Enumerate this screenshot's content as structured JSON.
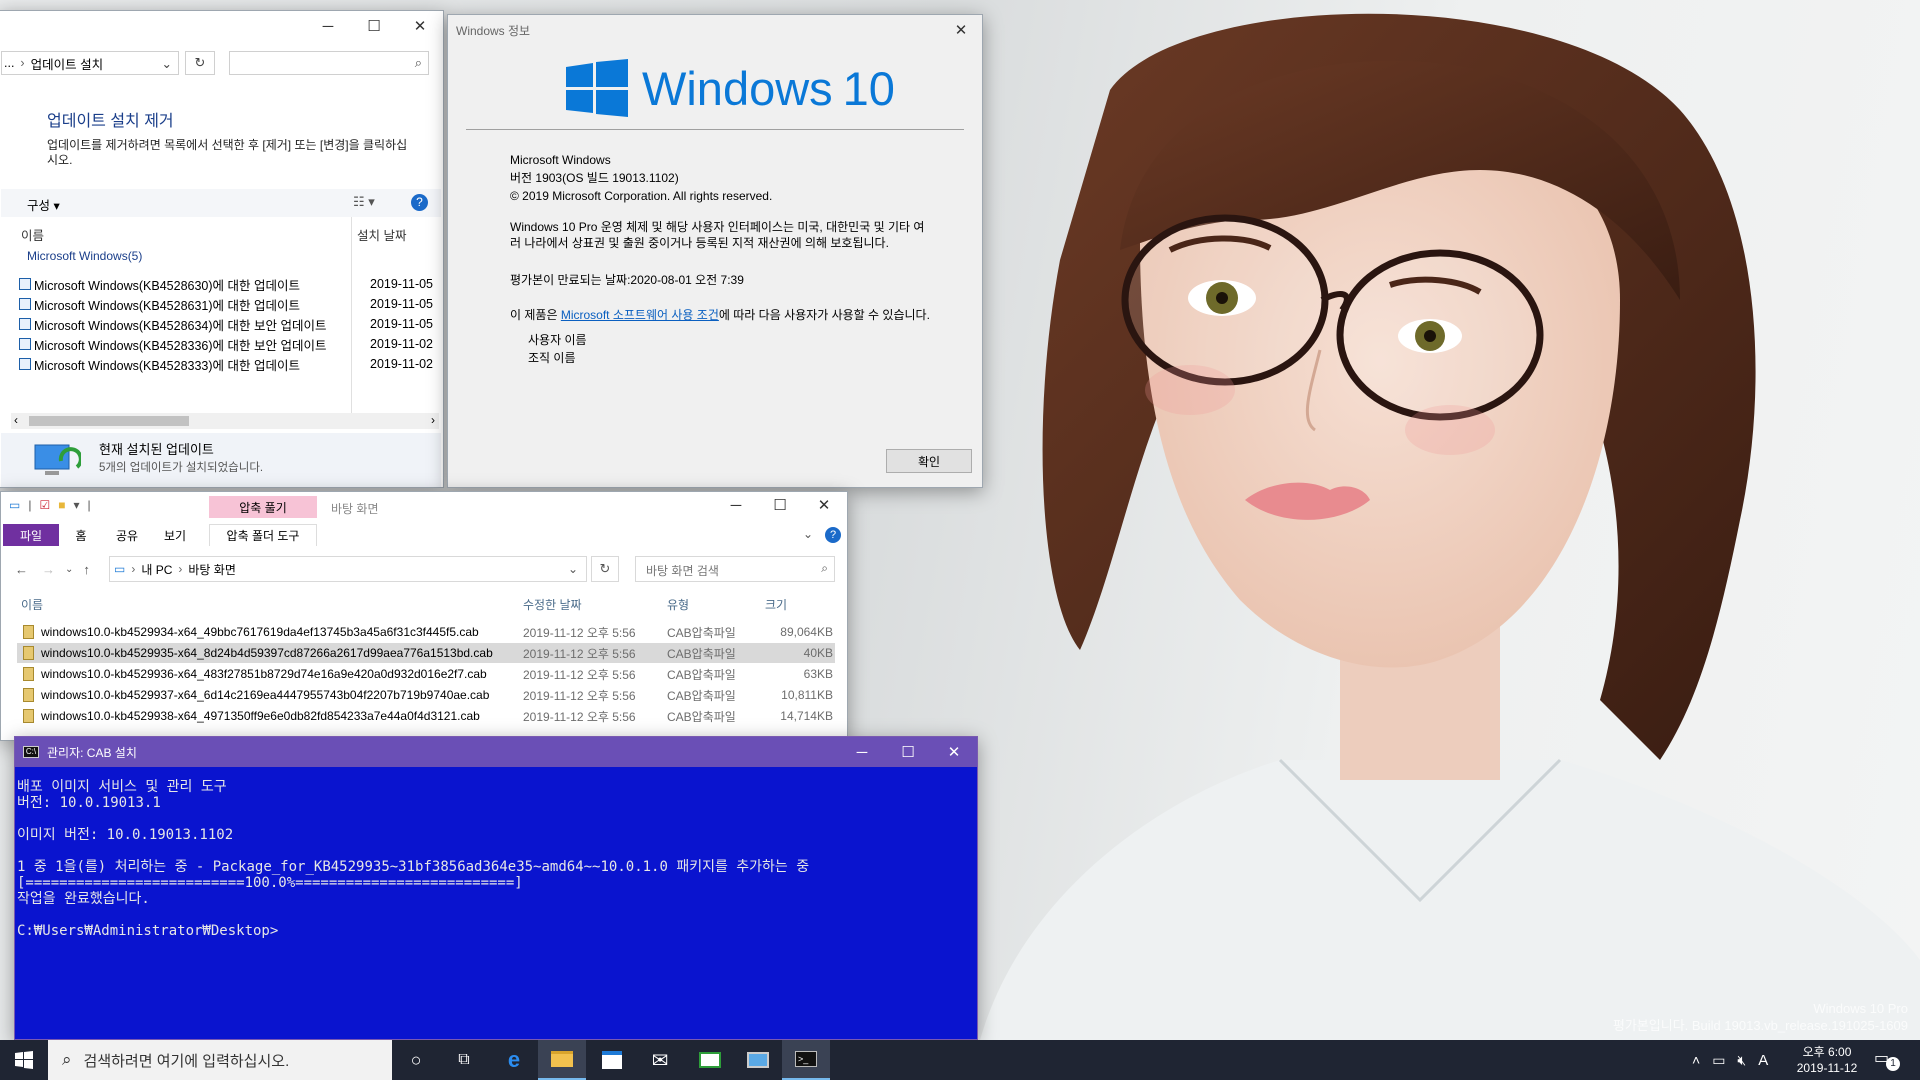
{
  "update_window": {
    "breadcrumb_prefix": "...",
    "breadcrumb": "업데이트 설치",
    "heading": "업데이트 설치 제거",
    "description": "업데이트를 제거하려면 목록에서 선택한 후 [제거] 또는 [변경]을 클릭하십시오.",
    "organize": "구성",
    "col_name": "이름",
    "col_date": "설치 날짜",
    "group": "Microsoft Windows(5)",
    "rows": [
      {
        "name": "Microsoft Windows(KB4528630)에 대한 업데이트",
        "date": "2019-11-05"
      },
      {
        "name": "Microsoft Windows(KB4528631)에 대한 업데이트",
        "date": "2019-11-05"
      },
      {
        "name": "Microsoft Windows(KB4528634)에 대한 보안 업데이트",
        "date": "2019-11-05"
      },
      {
        "name": "Microsoft Windows(KB4528336)에 대한 보안 업데이트",
        "date": "2019-11-02"
      },
      {
        "name": "Microsoft Windows(KB4528333)에 대한 업데이트",
        "date": "2019-11-02"
      }
    ],
    "footer_title": "현재 설치된 업데이트",
    "footer_sub": "5개의 업데이트가 설치되었습니다."
  },
  "about_window": {
    "title": "Windows 정보",
    "logo_text": "Windows",
    "logo_version": "10",
    "line1": "Microsoft Windows",
    "line2": "버전 1903(OS 빌드 19013.1102)",
    "line3": "© 2019 Microsoft Corporation. All rights reserved.",
    "para1": "Windows 10 Pro 운영 체제 및 해당 사용자 인터페이스는 미국, 대한민국 및 기타 여러 나라에서 상표권 및 출원 중이거나 등록된 지적 재산권에 의해 보호됩니다.",
    "expiry": "평가본이 만료되는 날짜:2020-08-01 오전 7:39",
    "license_pre": "이 제품은 ",
    "license_link": "Microsoft 소프트웨어 사용 조건",
    "license_post": "에 따라 다음 사용자가 사용할 수 있습니다.",
    "user": "사용자 이름",
    "org": "조직 이름",
    "ok": "확인"
  },
  "explorer": {
    "context_tab": "압축 풀기",
    "title": "바탕 화면",
    "tabs": [
      "파일",
      "홈",
      "공유",
      "보기",
      "압축 폴더 도구"
    ],
    "path": [
      "내 PC",
      "바탕 화면"
    ],
    "search_placeholder": "바탕 화면 검색",
    "cols": [
      "이름",
      "수정한 날짜",
      "유형",
      "크기"
    ],
    "files": [
      {
        "name": "windows10.0-kb4529934-x64_49bbc7617619da4ef13745b3a45a6f31c3f445f5.cab",
        "date": "2019-11-12 오후 5:56",
        "type": "CAB압축파일",
        "size": "89,064KB"
      },
      {
        "name": "windows10.0-kb4529935-x64_8d24b4d59397cd87266a2617d99aea776a1513bd.cab",
        "date": "2019-11-12 오후 5:56",
        "type": "CAB압축파일",
        "size": "40KB"
      },
      {
        "name": "windows10.0-kb4529936-x64_483f27851b8729d74e16a9e420a0d932d016e2f7.cab",
        "date": "2019-11-12 오후 5:56",
        "type": "CAB압축파일",
        "size": "63KB"
      },
      {
        "name": "windows10.0-kb4529937-x64_6d14c2169ea4447955743b04f2207b719b9740ae.cab",
        "date": "2019-11-12 오후 5:56",
        "type": "CAB압축파일",
        "size": "10,811KB"
      },
      {
        "name": "windows10.0-kb4529938-x64_4971350ff9e6e0db82fd854233a7e44a0f4d3121.cab",
        "date": "2019-11-12 오후 5:56",
        "type": "CAB압축파일",
        "size": "14,714KB"
      }
    ]
  },
  "console": {
    "title": "관리자:  CAB 설치",
    "lines": [
      "배포 이미지 서비스 및 관리 도구",
      "버전: 10.0.19013.1",
      "",
      "이미지 버전: 10.0.19013.1102",
      "",
      "1 중 1을(를) 처리하는 중 - Package_for_KB4529935~31bf3856ad364e35~amd64~~10.0.1.0 패키지를 추가하는 중",
      "[==========================100.0%==========================]",
      "작업을 완료했습니다.",
      "",
      "C:₩Users₩Administrator₩Desktop>"
    ],
    "bg": "#0000cc"
  },
  "watermark": {
    "line1": "Windows 10 Pro",
    "line2": "평가본입니다. Build 19013.vb_release.191025-1609"
  },
  "taskbar": {
    "search_placeholder": "검색하려면 여기에 입력하십시오.",
    "ime": "A",
    "time": "오후 6:00",
    "date": "2019-11-12",
    "notif_count": "1"
  }
}
